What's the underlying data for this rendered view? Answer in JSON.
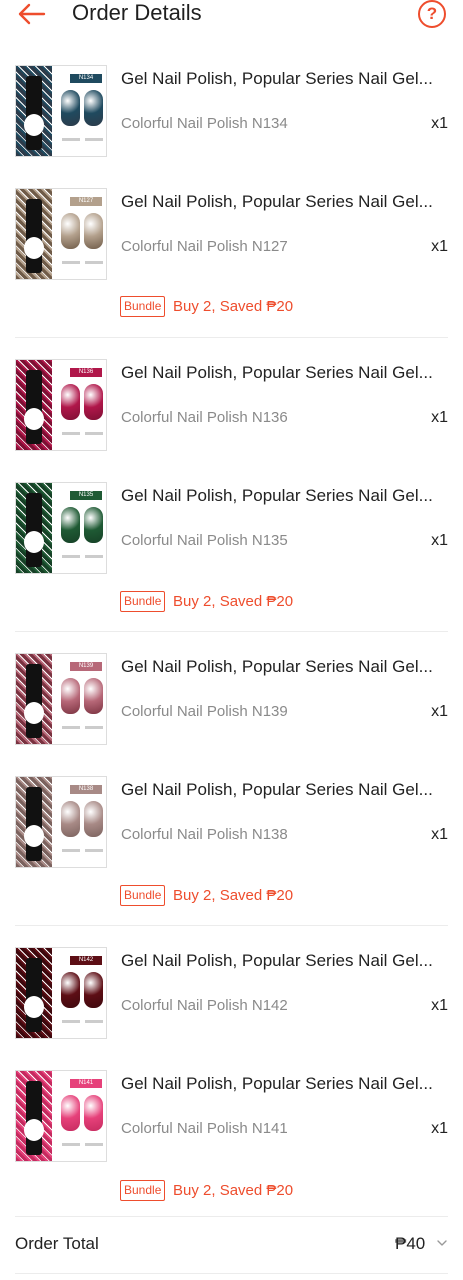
{
  "header": {
    "title": "Order Details",
    "back_icon": "arrow-left-icon",
    "help_icon": "question-circle-icon",
    "help_glyph": "?",
    "accent": "#ee4d2d"
  },
  "items": [
    {
      "name": "Gel Nail Polish, Popular Series Nail Gel...",
      "variation": "Colorful Nail Polish N134",
      "qty": "x1",
      "code": "N134",
      "color": "#1f4a5f",
      "glitter": "#2d3b4a"
    },
    {
      "name": "Gel Nail Polish, Popular Series Nail Gel...",
      "variation": "Colorful Nail Polish N127",
      "qty": "x1",
      "code": "N127",
      "color": "#b3a08c",
      "glitter": "#6f5b48"
    },
    {
      "name": "Gel Nail Polish, Popular Series Nail Gel...",
      "variation": "Colorful Nail Polish N136",
      "qty": "x1",
      "code": "N136",
      "color": "#b0174a",
      "glitter": "#7d0f33"
    },
    {
      "name": "Gel Nail Polish, Popular Series Nail Gel...",
      "variation": "Colorful Nail Polish N135",
      "qty": "x1",
      "code": "N135",
      "color": "#1f5a34",
      "glitter": "#164026"
    },
    {
      "name": "Gel Nail Polish, Popular Series Nail Gel...",
      "variation": "Colorful Nail Polish N139",
      "qty": "x1",
      "code": "N139",
      "color": "#b76878",
      "glitter": "#7a3240"
    },
    {
      "name": "Gel Nail Polish, Popular Series Nail Gel...",
      "variation": "Colorful Nail Polish N138",
      "qty": "x1",
      "code": "N138",
      "color": "#a88a86",
      "glitter": "#7b625e"
    },
    {
      "name": "Gel Nail Polish, Popular Series Nail Gel...",
      "variation": "Colorful Nail Polish N142",
      "qty": "x1",
      "code": "N142",
      "color": "#5d0e15",
      "glitter": "#3d080d"
    },
    {
      "name": "Gel Nail Polish, Popular Series Nail Gel...",
      "variation": "Colorful Nail Polish N141",
      "qty": "x1",
      "code": "N141",
      "color": "#e6417a",
      "glitter": "#c52a5f"
    }
  ],
  "bundles": [
    {
      "tag": "Bundle",
      "text": "Buy 2, Saved ₱20"
    },
    {
      "tag": "Bundle",
      "text": "Buy 2, Saved ₱20"
    },
    {
      "tag": "Bundle",
      "text": "Buy 2, Saved ₱20"
    },
    {
      "tag": "Bundle",
      "text": "Buy 2, Saved ₱20"
    }
  ],
  "order_total": {
    "label": "Order Total",
    "value": "₱40",
    "chevron_icon": "chevron-down-icon"
  }
}
